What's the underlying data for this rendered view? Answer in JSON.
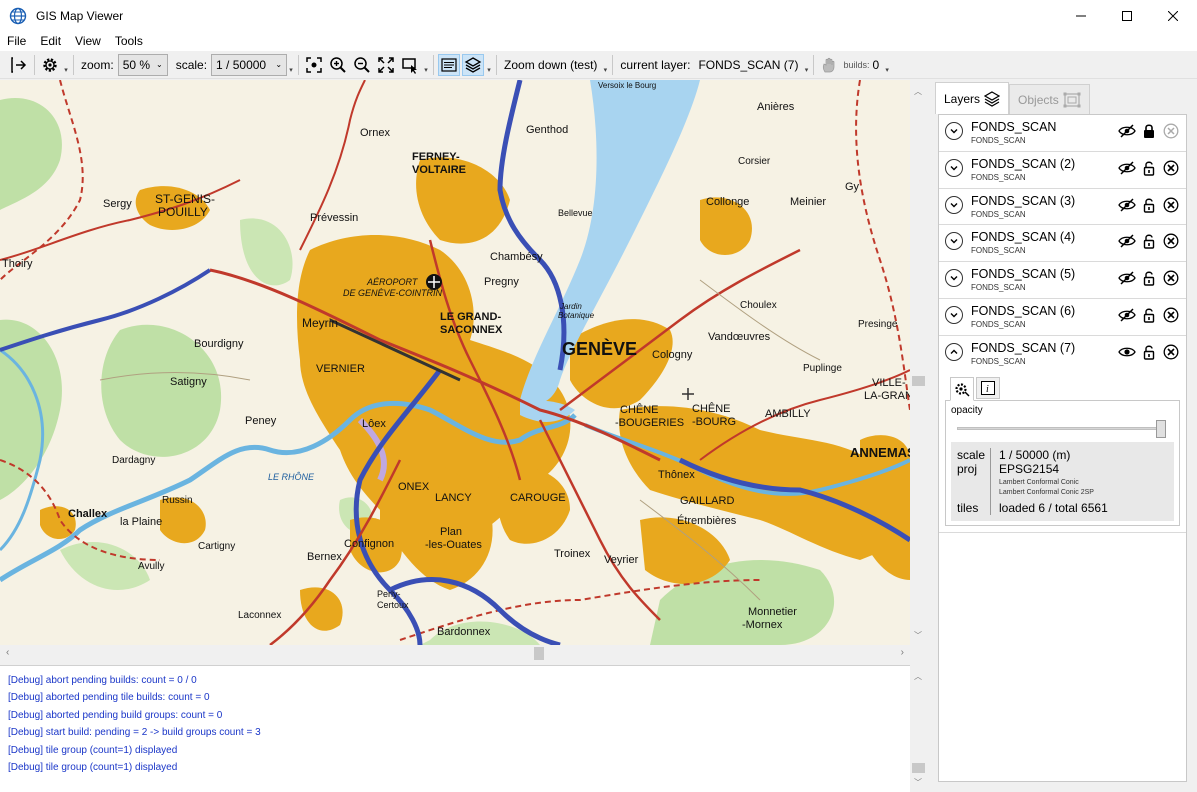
{
  "window": {
    "title": "GIS Map Viewer"
  },
  "menu": [
    "File",
    "Edit",
    "View",
    "Tools"
  ],
  "toolbar": {
    "zoom_label": "zoom:",
    "zoom_value": "50 %",
    "scale_label": "scale:",
    "scale_value": "1 / 50000",
    "zoom_down_label": "Zoom down (test)",
    "current_layer_label": "current layer:",
    "current_layer_value": "FONDS_SCAN (7)",
    "builds_label": "builds:",
    "builds_value": "0"
  },
  "map": {
    "labels": {
      "geneve": "GENÈVE",
      "grand_saconnex": "LE GRAND-\nSACONNEX",
      "ferney": "FERNEY-\nVOLTAIRE",
      "st_genis": "ST-GENIS-\nPOUILLY",
      "meyrin": "Meyrin",
      "vernier": "VERNIER",
      "onex": "ONEX",
      "lancy": "LANCY",
      "carouge": "CAROUGE",
      "annemasse": "ANNEMAS",
      "thonex": "Thônex",
      "chene": "CHÊNE\n-BOURG",
      "cologny": "Cologny",
      "pregny": "Pregny",
      "chambesy": "Chambésy",
      "collonge": "Collonge",
      "meinier": "Meinier",
      "vandoeuvres": "Vandœuvres",
      "satigny": "Satigny",
      "bourdigny": "Bourdigny",
      "peney": "Peney",
      "bernex": "Bernex",
      "confignon": "Confignon",
      "plan_les_ouates": "Plan\n-les-Ouates",
      "troinex": "Troinex",
      "veyrier": "Veyrier",
      "bardonnex": "Bardonnex",
      "gaillard": "GAILLARD",
      "etrembieres": "Étrembières",
      "chaix": "Challex",
      "la_plaine": "la Plaine",
      "russin": "Russin",
      "dardagny": "Dardagny",
      "avully": "Avully",
      "cartigny": "Cartigny",
      "sergy": "Sergy",
      "thoiry": "Thoiry",
      "ornex": "Ornex",
      "prevessin": "Prévessin",
      "genthod": "Genthod",
      "bellevue": "Bellevue",
      "versoix": "Versoix le Bourg",
      "anieres": "Anières",
      "corsier": "Corsier",
      "gy": "Gy",
      "choulex": "Choulex",
      "presinge": "Presinge",
      "puplinge": "Puplinge",
      "ambilly": "AMBILLY",
      "ville_la_grand": "VILLE-\nLA-GRAN",
      "monnetier": "Monnetier\n-Mornex",
      "laconnex": "Laconnex",
      "perly": "Perly-\nCertoux",
      "aeroport": "AÉROPORT\nDE GENÈVE-COINTRIN",
      "loex": "Lôex",
      "chene_bougeries": "CHÊNE\n-BOUGERIES",
      "le_rhone": "LE RHÔNE",
      "lake_label": "Jardin\nBotanique"
    }
  },
  "console": {
    "lines": [
      "[Debug] abort pending builds: count = 0 / 0",
      "[Debug] aborted pending tile builds: count = 0",
      "[Debug] aborted pending build groups: count = 0",
      "[Debug] start build: pending = 2 -> build groups count = 3",
      "[Debug] tile group (count=1) displayed",
      "[Debug] tile group (count=1) displayed"
    ]
  },
  "panel": {
    "tabs": [
      {
        "label": "Layers"
      },
      {
        "label": "Objects"
      }
    ],
    "layers": [
      {
        "name": "FONDS_SCAN",
        "sub": "FONDS_SCAN",
        "visible": false,
        "locked": true,
        "expanded": false
      },
      {
        "name": "FONDS_SCAN (2)",
        "sub": "FONDS_SCAN",
        "visible": false,
        "locked": false,
        "expanded": false
      },
      {
        "name": "FONDS_SCAN (3)",
        "sub": "FONDS_SCAN",
        "visible": false,
        "locked": false,
        "expanded": false
      },
      {
        "name": "FONDS_SCAN (4)",
        "sub": "FONDS_SCAN",
        "visible": false,
        "locked": false,
        "expanded": false
      },
      {
        "name": "FONDS_SCAN (5)",
        "sub": "FONDS_SCAN",
        "visible": false,
        "locked": false,
        "expanded": false
      },
      {
        "name": "FONDS_SCAN (6)",
        "sub": "FONDS_SCAN",
        "visible": false,
        "locked": false,
        "expanded": false
      },
      {
        "name": "FONDS_SCAN (7)",
        "sub": "FONDS_SCAN",
        "visible": true,
        "locked": false,
        "expanded": true
      }
    ],
    "detail": {
      "opacity_label": "opacity",
      "opacity": 1.0,
      "scale_key": "scale",
      "scale_value": "1 / 50000 (m)",
      "proj_key": "proj",
      "proj_value": "EPSG2154",
      "proj_sub1": "Lambert Conformal Conic",
      "proj_sub2": "Lambert Conformal Conic 2SP",
      "tiles_key": "tiles",
      "tiles_value": "loaded 6 / total 6561"
    }
  },
  "colors": {
    "urban": "#e8a81e",
    "water": "#a8d4f0",
    "forest": "#b9dca0",
    "road_major": "#c0392b",
    "highway": "#3a4fb5",
    "console_text": "#1a36c8"
  }
}
